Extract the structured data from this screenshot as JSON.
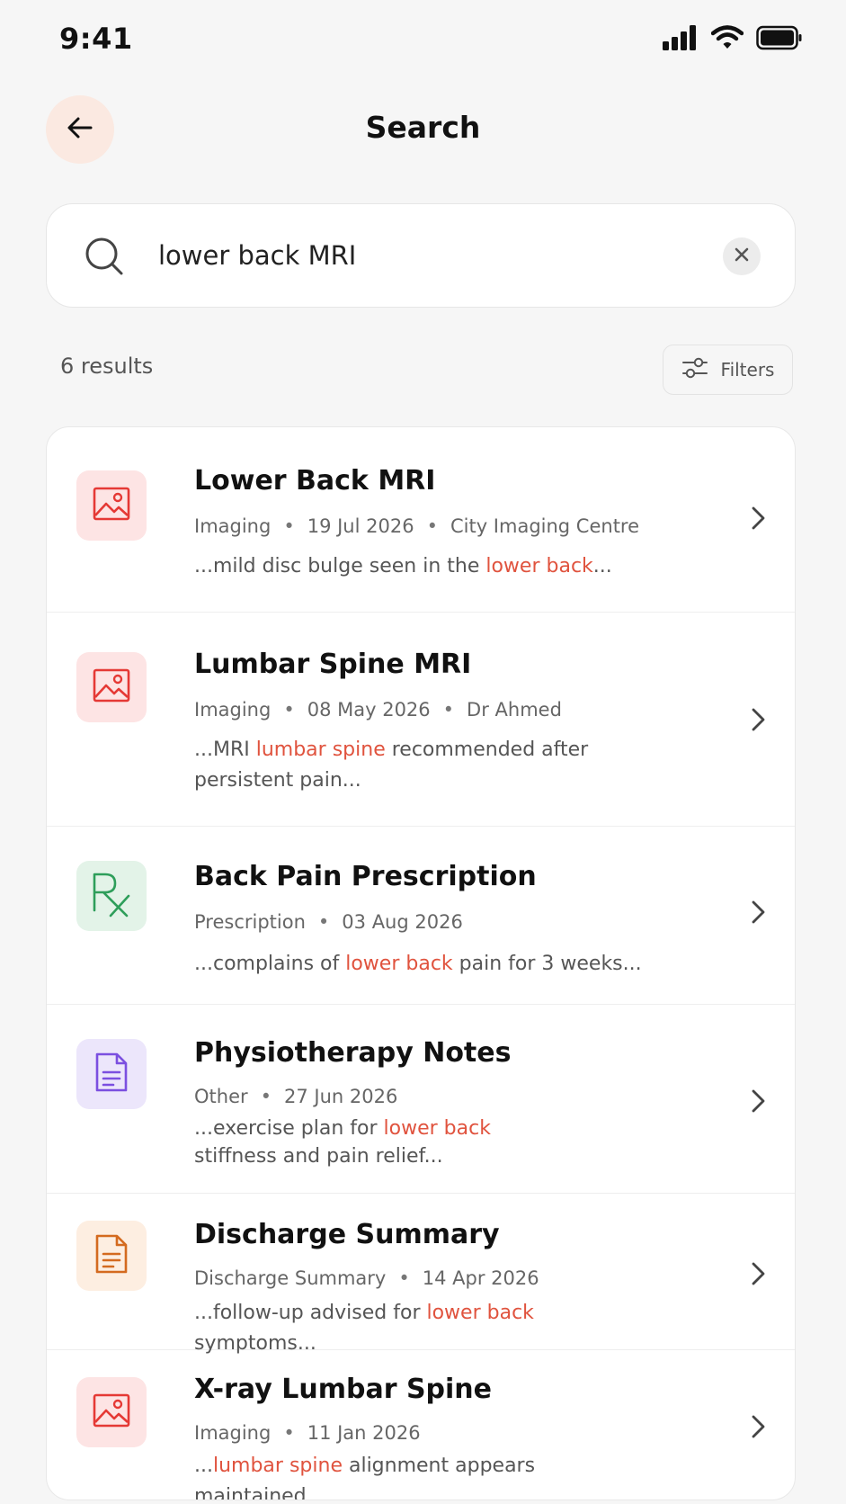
{
  "status_bar": {
    "time": "9:41",
    "icons": [
      "signal-icon",
      "wifi-icon",
      "battery-icon"
    ]
  },
  "header": {
    "title": "Search",
    "back_icon": "arrow-left-icon"
  },
  "search": {
    "value": "lower back MRI",
    "icon": "search-icon",
    "clear_icon": "close-icon"
  },
  "results_summary": {
    "count_text": "6 results",
    "filters_label": "Filters",
    "filters_icon": "sliders-icon"
  },
  "colors": {
    "highlight": "#e0533e",
    "imaging_bg": "#fde4e4",
    "imaging_fg": "#e53935",
    "prescription_bg": "#e3f3e8",
    "prescription_fg": "#2e9e5a",
    "other_bg": "#ece6fb",
    "other_fg": "#7b4fe0",
    "discharge_bg": "#fdeee1",
    "discharge_fg": "#d46a1f",
    "back_button_bg": "#fbe9e1"
  },
  "results": [
    {
      "title": "Lower Back MRI",
      "icon": "image-icon",
      "category": "imaging",
      "meta": [
        "Imaging",
        "19 Jul 2026",
        "City Imaging Centre"
      ],
      "snippet": [
        {
          "text": "...mild disc bulge seen in the ",
          "hl": false
        },
        {
          "text": "lower back",
          "hl": true
        },
        {
          "text": "...",
          "hl": false
        }
      ]
    },
    {
      "title": "Lumbar Spine MRI",
      "icon": "image-icon",
      "category": "imaging",
      "meta": [
        "Imaging",
        "08 May 2026",
        "Dr Ahmed"
      ],
      "snippet": [
        {
          "text": "...MRI ",
          "hl": false
        },
        {
          "text": "lumbar spine",
          "hl": true
        },
        {
          "text": " recommended after persistent pain...",
          "hl": false
        }
      ]
    },
    {
      "title": "Back Pain Prescription",
      "icon": "prescription-rx-icon",
      "category": "prescription",
      "meta": [
        "Prescription",
        "03 Aug 2026"
      ],
      "snippet": [
        {
          "text": "...complains of ",
          "hl": false
        },
        {
          "text": "lower back",
          "hl": true
        },
        {
          "text": " pain for 3 weeks...",
          "hl": false
        }
      ]
    },
    {
      "title": "Physiotherapy Notes",
      "icon": "document-icon",
      "category": "other",
      "meta": [
        "Other",
        "27 Jun 2026"
      ],
      "snippet": [
        {
          "text": "...exercise plan for ",
          "hl": false
        },
        {
          "text": "lower back",
          "hl": true
        },
        {
          "text": " stiffness and pain relief...",
          "hl": false
        }
      ]
    },
    {
      "title": "Discharge Summary",
      "icon": "document-icon",
      "category": "discharge",
      "meta": [
        "Discharge Summary",
        "14 Apr 2026"
      ],
      "snippet": [
        {
          "text": "...follow-up advised for ",
          "hl": false
        },
        {
          "text": "lower back",
          "hl": true
        },
        {
          "text": " symptoms...",
          "hl": false
        }
      ]
    },
    {
      "title": "X-ray Lumbar Spine",
      "icon": "image-icon",
      "category": "imaging",
      "meta": [
        "Imaging",
        "11 Jan 2026"
      ],
      "snippet": [
        {
          "text": "...",
          "hl": false
        },
        {
          "text": "lumbar spine",
          "hl": true
        },
        {
          "text": " alignment appears maintained...",
          "hl": false
        }
      ]
    }
  ]
}
